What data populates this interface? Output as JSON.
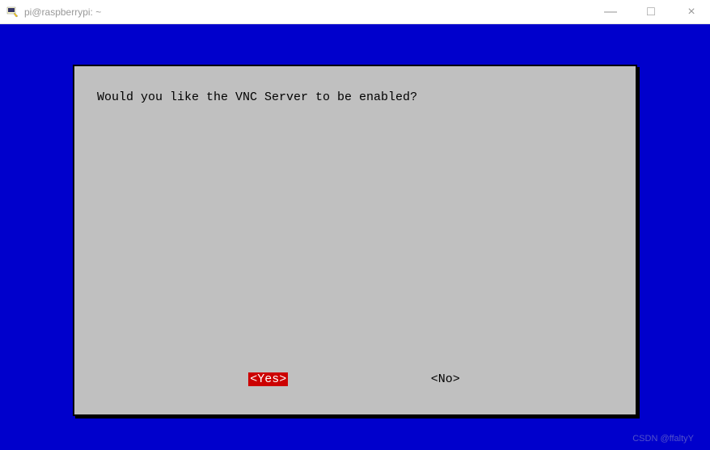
{
  "window": {
    "title": "pi@raspberrypi: ~",
    "controls": {
      "minimize": "—",
      "maximize": "□",
      "close": "×"
    }
  },
  "dialog": {
    "question": "Would you like the VNC Server to be enabled?",
    "buttons": {
      "yes": "<Yes>",
      "no": "<No>"
    },
    "selected": "yes"
  },
  "watermark": "CSDN @ffaltyY"
}
